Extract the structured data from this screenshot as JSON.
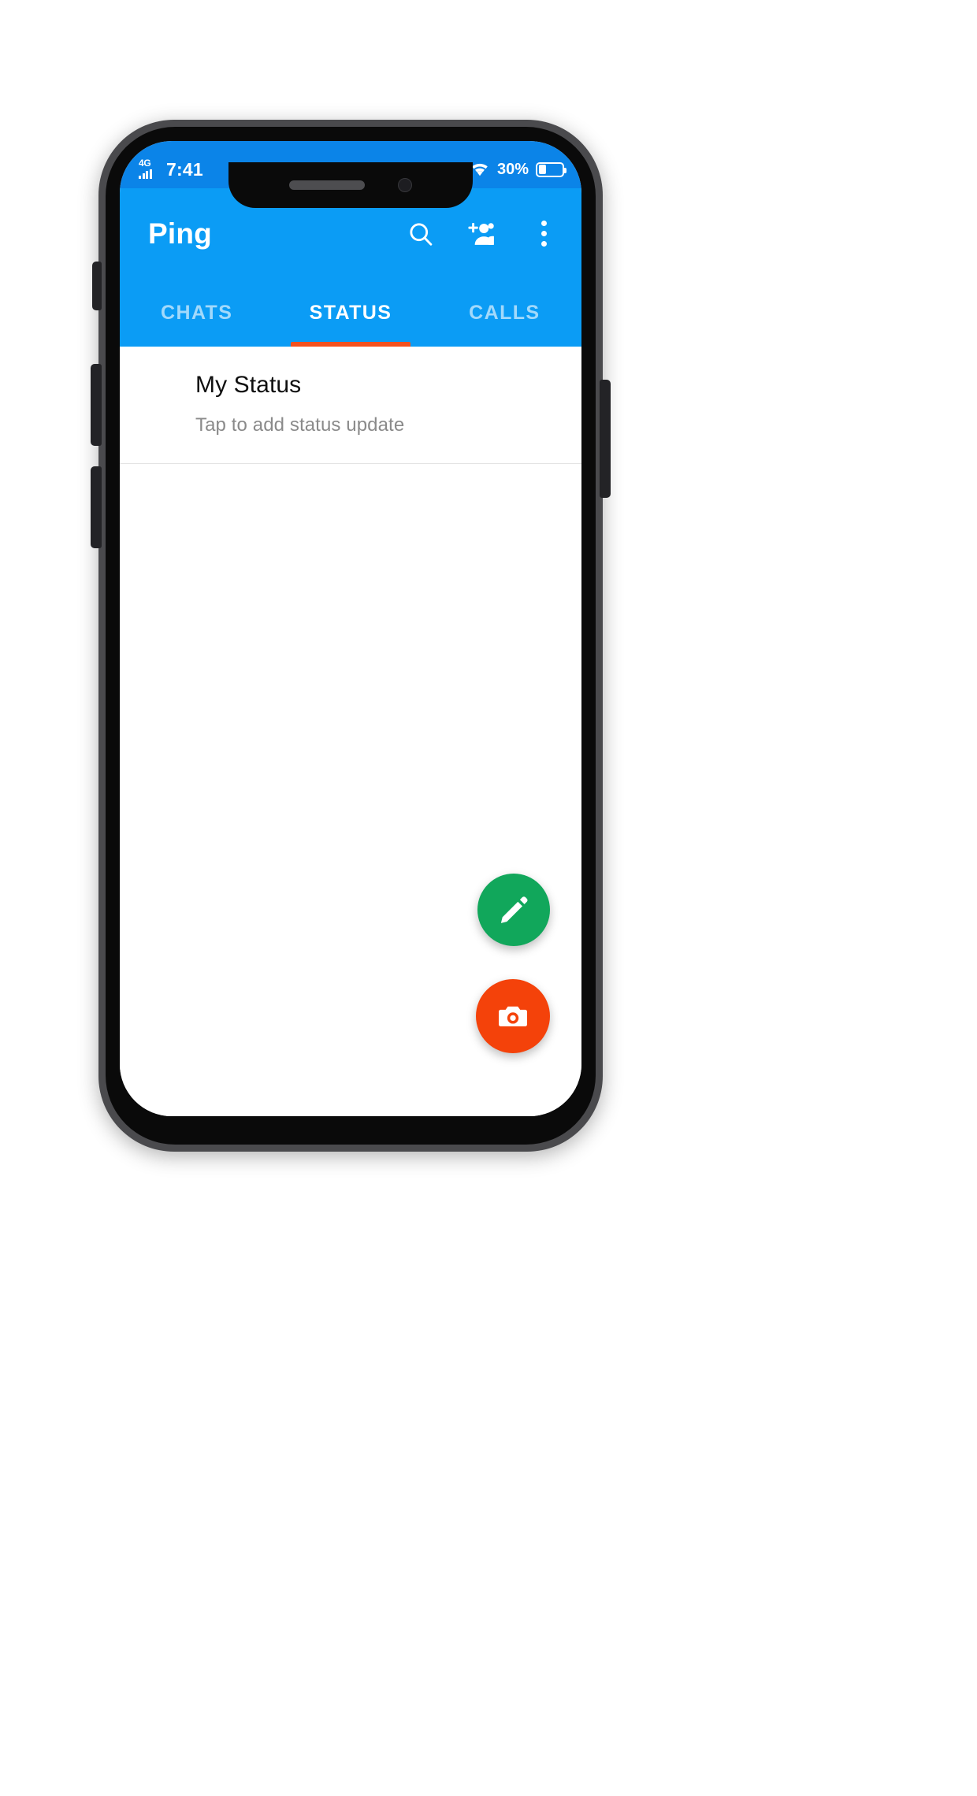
{
  "status_bar": {
    "network_label": "4G",
    "signal_icon": "signal-bars-icon",
    "time": "7:41",
    "wifi_icon": "wifi-icon",
    "battery_percent": "30%",
    "battery_level": 30,
    "battery_icon": "battery-icon"
  },
  "app_bar": {
    "title": "Ping",
    "actions": [
      {
        "name": "search-icon",
        "label": "Search"
      },
      {
        "name": "add-person-icon",
        "label": "New group"
      },
      {
        "name": "overflow-menu-icon",
        "label": "More options"
      }
    ]
  },
  "tabs": {
    "items": [
      {
        "label": "CHATS",
        "active": false
      },
      {
        "label": "STATUS",
        "active": true
      },
      {
        "label": "CALLS",
        "active": false
      }
    ],
    "indicator_color": "#f4511e"
  },
  "content": {
    "my_status": {
      "title": "My Status",
      "subtitle": "Tap to add status update"
    }
  },
  "fabs": [
    {
      "name": "edit-status-fab",
      "icon": "pencil-icon",
      "color": "#11a75b"
    },
    {
      "name": "camera-fab",
      "icon": "camera-icon",
      "color": "#f4420a"
    }
  ],
  "colors": {
    "app_bar": "#0b9cf5",
    "status_bar": "#0b84e8",
    "tab_indicator": "#f4511e",
    "fab_edit": "#11a75b",
    "fab_camera": "#f4420a"
  },
  "device": {
    "side_buttons": [
      "silent-switch",
      "volume-up-button",
      "volume-down-button",
      "power-button"
    ]
  }
}
